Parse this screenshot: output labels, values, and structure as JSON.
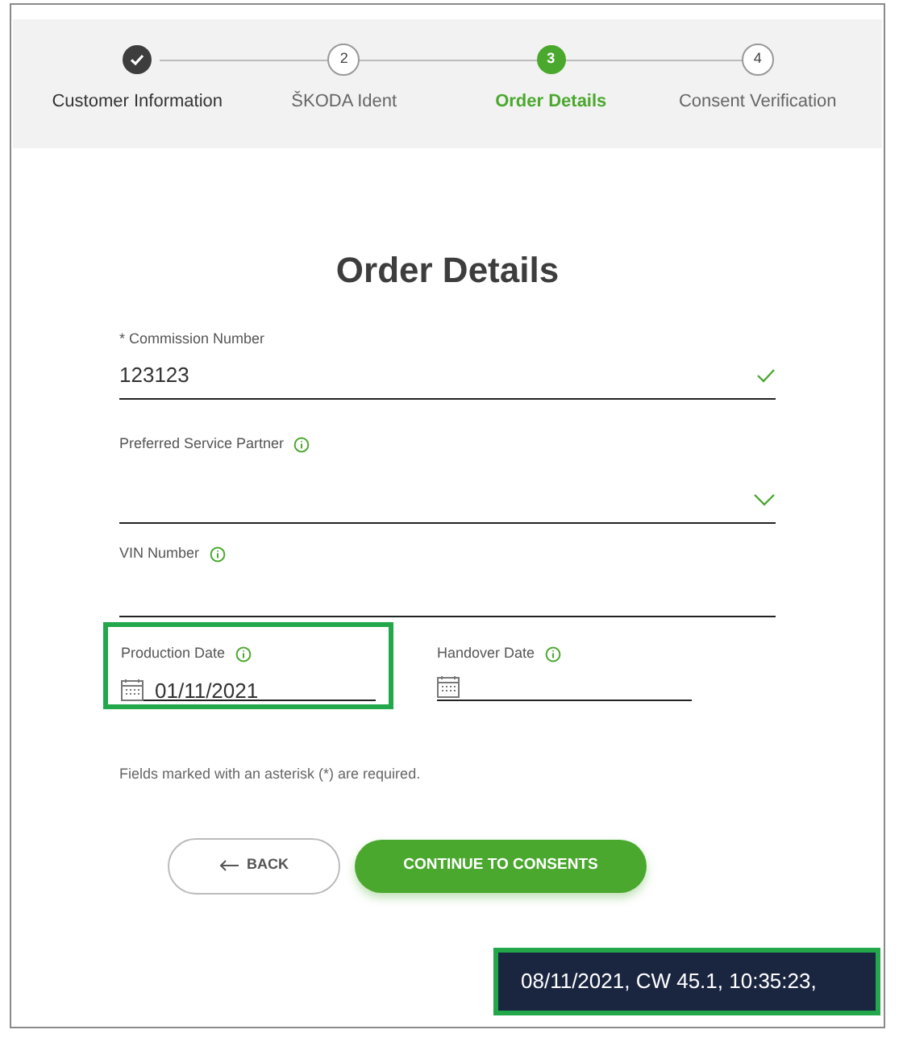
{
  "steps": [
    {
      "label": "Customer Information",
      "kind": "done"
    },
    {
      "number": "2",
      "label": "ŠKODA Ident",
      "kind": "upcoming"
    },
    {
      "number": "3",
      "label": "Order Details",
      "kind": "current"
    },
    {
      "number": "4",
      "label": "Consent Verification",
      "kind": "upcoming"
    }
  ],
  "title": "Order Details",
  "fields": [
    {
      "kind": "text",
      "label": "* Commission Number",
      "value": "123123",
      "info": false,
      "valid": true
    },
    {
      "kind": "select",
      "label": "Preferred Service Partner",
      "info": true,
      "valid": false
    },
    {
      "kind": "text",
      "label": "VIN Number",
      "info": true,
      "valid": false
    }
  ],
  "dates": [
    {
      "label": "Production Date",
      "value": "01/11/2021",
      "highlighted": true
    },
    {
      "label": "Handover Date",
      "highlighted": false
    }
  ],
  "note": "Fields marked with an asterisk (*) are required.",
  "back_button": "BACK",
  "continue_button": "CONTINUE TO CONSENTS",
  "timestamp": {
    "text": "08/11/2021, CW 45.1, 10:35:23,",
    "highlighted": true
  }
}
